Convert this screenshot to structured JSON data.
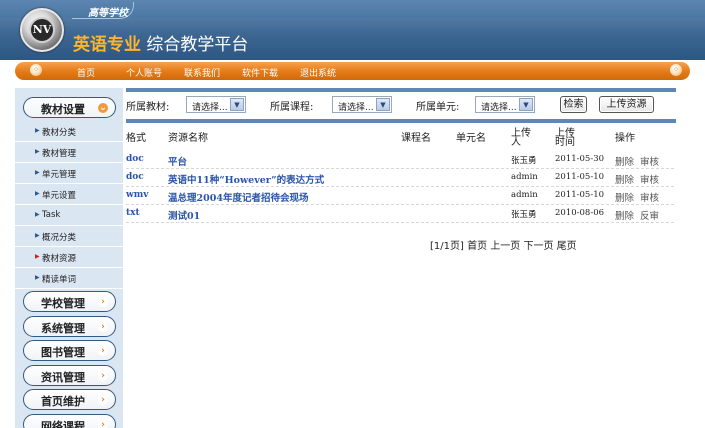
{
  "header": {
    "school": "高等学校",
    "title_highlight": "英语专业",
    "title_rest": "综合教学平台"
  },
  "nav": [
    "首页",
    "个人账号",
    "联系我们",
    "软件下载",
    "退出系统"
  ],
  "sidebar": {
    "groups": [
      {
        "label": "教材设置",
        "arrow": "⌄"
      },
      {
        "label": "学校管理",
        "arrow": "›"
      },
      {
        "label": "系统管理",
        "arrow": "›"
      },
      {
        "label": "图书管理",
        "arrow": "›"
      },
      {
        "label": "资讯管理",
        "arrow": "›"
      },
      {
        "label": "首页维护",
        "arrow": "›"
      },
      {
        "label": "网络课程",
        "arrow": "›"
      }
    ],
    "items": [
      "教材分类",
      "教材管理",
      "单元管理",
      "单元设置",
      "Task",
      "概况分类",
      "教材资源",
      "精读单词"
    ],
    "bullet": "▶"
  },
  "filters": {
    "textbook_label": "所属教材:",
    "course_label": "所属课程:",
    "unit_label": "所属单元:",
    "select_value": "请选择...",
    "dropdown": "▼",
    "search": "检索",
    "upload": "上传资源"
  },
  "table": {
    "headers": {
      "format": "格式",
      "name": "资源名称",
      "course": "课程名",
      "unit": "单元名",
      "uploader_1": "上传",
      "uploader_2": "人",
      "time_1": "上传",
      "time_2": "时间",
      "ops": "操作"
    },
    "rows": [
      {
        "format": "doc",
        "name": "平台",
        "uploader": "张玉勇",
        "date": "2011-05-30",
        "op1": "删除",
        "op2": "审核"
      },
      {
        "format": "doc",
        "name": "英语中11种“However”的表达方式",
        "uploader": "admin",
        "date": "2011-05-10",
        "op1": "删除",
        "op2": "审核"
      },
      {
        "format": "wmv",
        "name": "温总理2004年度记者招待会现场",
        "uploader": "admin",
        "date": "2011-05-10",
        "op1": "删除",
        "op2": "审核"
      },
      {
        "format": "txt",
        "name": "测试01",
        "uploader": "张玉勇",
        "date": "2010-08-06",
        "op1": "删除",
        "op2": "反审"
      }
    ]
  },
  "pager": {
    "info": "[1/1页]",
    "first": "首页",
    "prev": "上一页",
    "next": "下一页",
    "last": "尾页"
  },
  "logo_text": "NV",
  "nav_dot_left": "◦",
  "nav_dot_right": "◦"
}
